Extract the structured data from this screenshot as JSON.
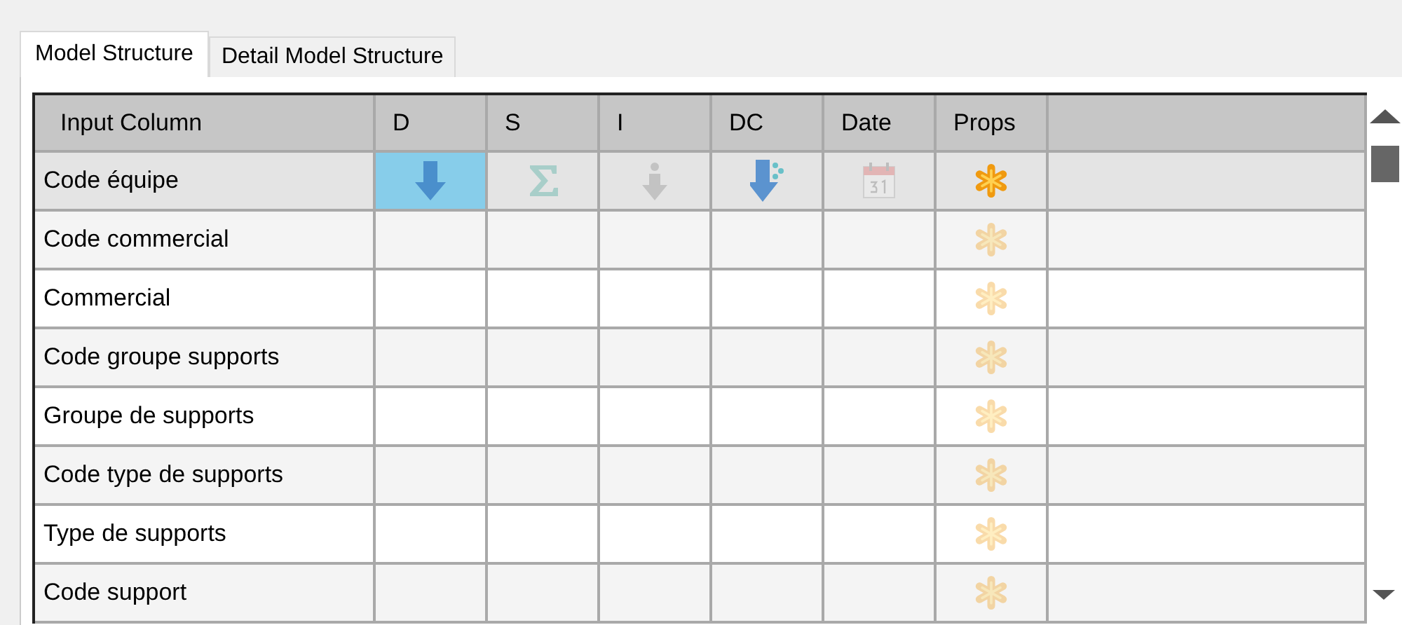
{
  "tabs": [
    {
      "label": "Model Structure",
      "selected": true
    },
    {
      "label": "Detail Model Structure",
      "selected": false
    }
  ],
  "table": {
    "columns": [
      {
        "label": "Input Column"
      },
      {
        "label": "D"
      },
      {
        "label": "S"
      },
      {
        "label": "I"
      },
      {
        "label": "DC"
      },
      {
        "label": "Date"
      },
      {
        "label": "Props"
      }
    ],
    "rows": [
      {
        "name": "Code équipe",
        "selected": true,
        "cells": [
          {
            "kind": "arrow",
            "selected": true,
            "dim": false
          },
          {
            "kind": "sigma",
            "selected": false,
            "dim": true
          },
          {
            "kind": "grey-arrow",
            "selected": false,
            "dim": true
          },
          {
            "kind": "split-arrow",
            "selected": false,
            "dim": false
          },
          {
            "kind": "calendar",
            "selected": false,
            "dim": true
          },
          {
            "kind": "asterisk",
            "selected": false,
            "dim": false
          }
        ]
      },
      {
        "name": "Code commercial",
        "selected": false,
        "cells": [
          {
            "kind": "empty",
            "selected": false
          },
          {
            "kind": "empty",
            "selected": false
          },
          {
            "kind": "empty",
            "selected": false
          },
          {
            "kind": "empty",
            "selected": false
          },
          {
            "kind": "empty",
            "selected": false
          },
          {
            "kind": "asterisk",
            "selected": false,
            "dim": true
          }
        ]
      },
      {
        "name": "Commercial",
        "selected": false,
        "cells": [
          {
            "kind": "empty",
            "selected": false
          },
          {
            "kind": "empty",
            "selected": false
          },
          {
            "kind": "empty",
            "selected": false
          },
          {
            "kind": "empty",
            "selected": false
          },
          {
            "kind": "empty",
            "selected": false
          },
          {
            "kind": "asterisk",
            "selected": false,
            "dim": true
          }
        ]
      },
      {
        "name": "Code groupe supports",
        "selected": false,
        "cells": [
          {
            "kind": "empty",
            "selected": false
          },
          {
            "kind": "empty",
            "selected": false
          },
          {
            "kind": "empty",
            "selected": false
          },
          {
            "kind": "empty",
            "selected": false
          },
          {
            "kind": "empty",
            "selected": false
          },
          {
            "kind": "asterisk",
            "selected": false,
            "dim": true
          }
        ]
      },
      {
        "name": "Groupe de supports",
        "selected": false,
        "cells": [
          {
            "kind": "empty",
            "selected": false
          },
          {
            "kind": "empty",
            "selected": false
          },
          {
            "kind": "empty",
            "selected": false
          },
          {
            "kind": "empty",
            "selected": false
          },
          {
            "kind": "empty",
            "selected": false
          },
          {
            "kind": "asterisk",
            "selected": false,
            "dim": true
          }
        ]
      },
      {
        "name": "Code type de supports",
        "selected": false,
        "cells": [
          {
            "kind": "empty",
            "selected": false
          },
          {
            "kind": "empty",
            "selected": false
          },
          {
            "kind": "empty",
            "selected": false
          },
          {
            "kind": "empty",
            "selected": false
          },
          {
            "kind": "empty",
            "selected": false
          },
          {
            "kind": "asterisk",
            "selected": false,
            "dim": true
          }
        ]
      },
      {
        "name": "Type de supports",
        "selected": false,
        "cells": [
          {
            "kind": "empty",
            "selected": false
          },
          {
            "kind": "empty",
            "selected": false
          },
          {
            "kind": "empty",
            "selected": false
          },
          {
            "kind": "empty",
            "selected": false
          },
          {
            "kind": "empty",
            "selected": false
          },
          {
            "kind": "asterisk",
            "selected": false,
            "dim": true
          }
        ]
      },
      {
        "name": "Code support",
        "selected": false,
        "cells": [
          {
            "kind": "empty",
            "selected": false
          },
          {
            "kind": "empty",
            "selected": false
          },
          {
            "kind": "empty",
            "selected": false
          },
          {
            "kind": "empty",
            "selected": false
          },
          {
            "kind": "empty",
            "selected": false
          },
          {
            "kind": "asterisk",
            "selected": false,
            "dim": true
          }
        ]
      }
    ]
  }
}
